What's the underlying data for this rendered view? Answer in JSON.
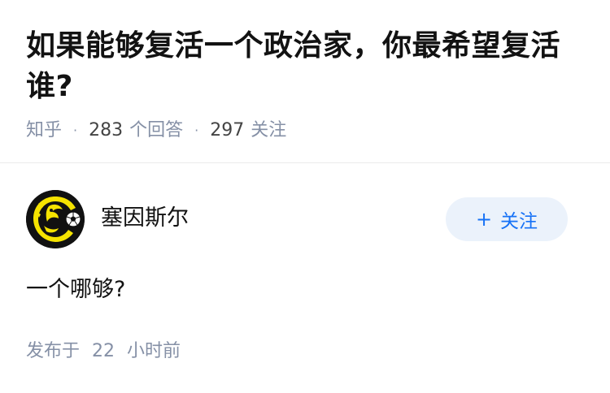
{
  "question": {
    "title": "如果能够复活一个政治家，你最希望复活谁?",
    "source": "知乎",
    "answer_count": "283",
    "answer_label": "个回答",
    "follower_count": "297",
    "follower_label": "关注"
  },
  "answer": {
    "author_name": "塞因斯尔",
    "avatar_icon": "yellow-dragon-logo",
    "follow_button": {
      "icon": "plus-icon",
      "plus_symbol": "+",
      "label": "关注"
    },
    "content": "一个哪够?",
    "publish_prefix": "发布于",
    "publish_number": "22",
    "publish_unit": "小时前"
  },
  "colors": {
    "title": "#121212",
    "meta": "#8590a6",
    "accent": "#1772f6",
    "button_bg": "#ebf2fb",
    "avatar_yellow": "#f5e300"
  }
}
